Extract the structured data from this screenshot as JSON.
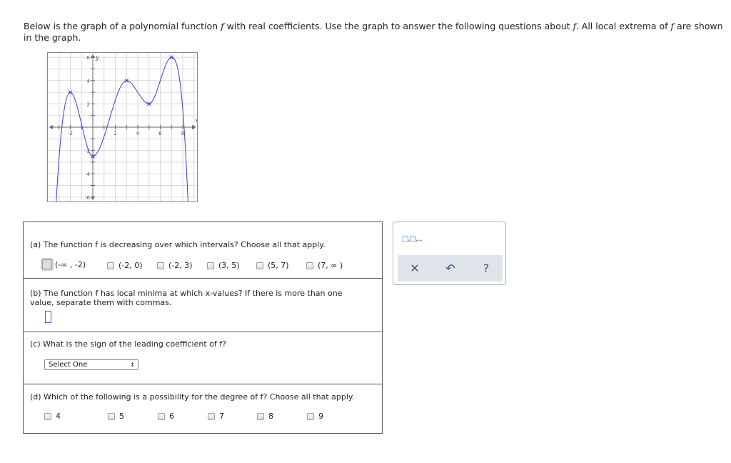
{
  "intro": {
    "p1": "Below is the graph of a polynomial function ",
    "f1": "f",
    "p2": " with real coefficients. Use the graph to answer the following questions about ",
    "f2": "f.",
    "p3": " All local extrema of ",
    "f3": "f",
    "p4": " are shown in the graph."
  },
  "graph": {
    "xlabel": "x",
    "ylabel": "y",
    "xticks": [
      "-2",
      "2",
      "4",
      "6",
      "8"
    ],
    "yticks": [
      "6",
      "4",
      "2",
      "-2",
      "-4",
      "-6"
    ],
    "curve_color": "#3a3ae0",
    "extrema": [
      {
        "x": -2,
        "y": 3
      },
      {
        "x": 0,
        "y": -2.5
      },
      {
        "x": 3,
        "y": 4
      },
      {
        "x": 5,
        "y": 2
      },
      {
        "x": 7,
        "y": 6
      }
    ]
  },
  "qa": {
    "text": "(a) The function f is decreasing over which intervals? Choose all that apply.",
    "options": [
      "(-∞ , -2)",
      "(-2, 0)",
      "(-2, 3)",
      "(3, 5)",
      "(5, 7)",
      "(7, ∞ )"
    ]
  },
  "qb": {
    "text": "(b) The function f has local minima at which x-values? If there is more than one value, separate them with commas."
  },
  "qc": {
    "text": "(c) What is the sign of the leading coefficient of f?",
    "select": "Select One"
  },
  "qd": {
    "text": "(d) Which of the following is a possibility for the degree of f? Choose all that apply.",
    "options": [
      "4",
      "5",
      "6",
      "7",
      "8",
      "9"
    ]
  },
  "tools": {
    "template": "□,□,...",
    "clear": "✕",
    "undo": "↶",
    "help": "?"
  }
}
